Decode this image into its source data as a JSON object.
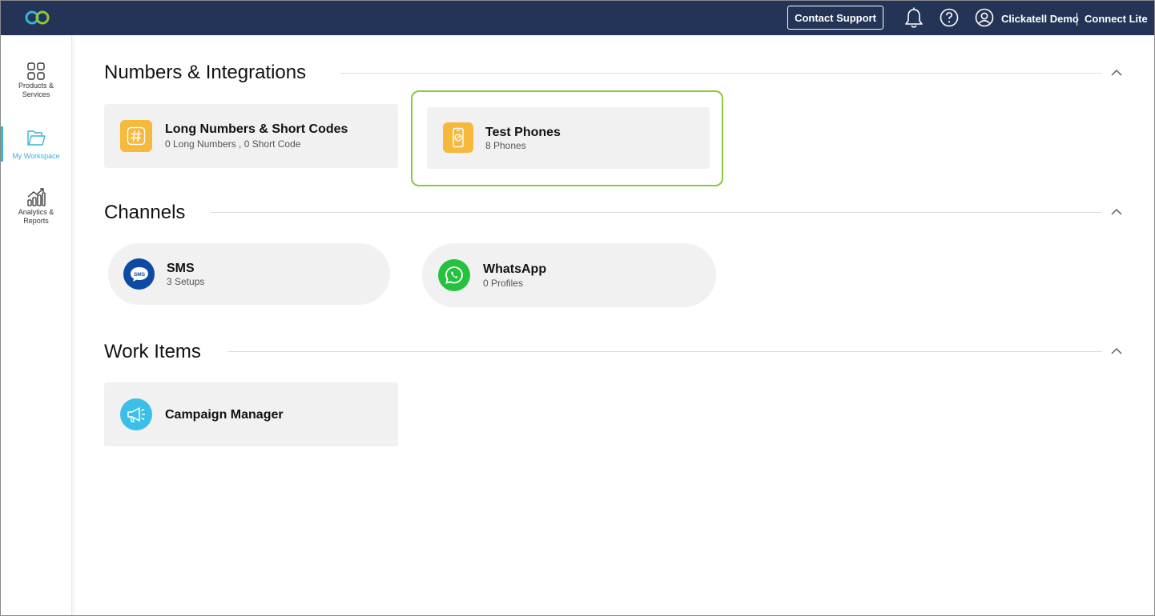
{
  "header": {
    "contact_support": "Contact Support",
    "user_name": "Clickatell Demo",
    "plan_name": "Connect Lite",
    "icons": [
      "bell-icon",
      "help-icon",
      "user-icon"
    ]
  },
  "sidebar": {
    "items": [
      {
        "label": "Products & Services",
        "icon": "grid-icon",
        "active": false
      },
      {
        "label": "My Workspace",
        "icon": "folder-icon",
        "active": true
      },
      {
        "label": "Analytics & Reports",
        "icon": "chart-icon",
        "active": false
      }
    ]
  },
  "sections": {
    "numbers": {
      "title": "Numbers & Integrations",
      "cards": [
        {
          "title": "Long Numbers & Short Codes",
          "subtitle": "0 Long Numbers ,  0 Short Code",
          "icon": "hash-icon"
        },
        {
          "title": "Test Phones",
          "subtitle": "8 Phones",
          "icon": "phone-icon"
        }
      ]
    },
    "channels": {
      "title": "Channels",
      "cards": [
        {
          "title": "SMS",
          "subtitle": "3 Setups",
          "icon": "sms-icon"
        },
        {
          "title": "WhatsApp",
          "subtitle": "0 Profiles",
          "icon": "whatsapp-icon"
        }
      ]
    },
    "work_items": {
      "title": "Work Items",
      "cards": [
        {
          "title": "Campaign Manager",
          "icon": "megaphone-icon"
        }
      ]
    }
  },
  "colors": {
    "topbar": "#233457",
    "accent": "#3bb2d8",
    "highlight": "#8dc63f",
    "card_bg": "#f1f1f1",
    "orange": "#f6b93b",
    "sms_blue": "#0d4aa3",
    "whatsapp_green": "#25c13f"
  }
}
